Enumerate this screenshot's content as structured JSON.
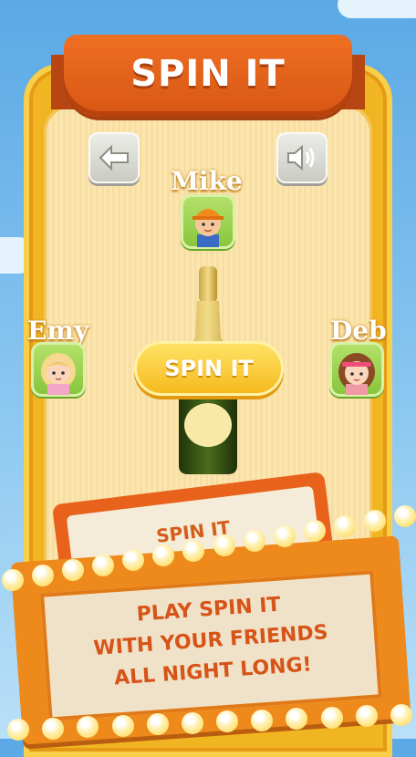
{
  "header": {
    "title": "SPIN IT"
  },
  "buttons": {
    "back": "back-arrow-icon",
    "sound": "speaker-icon",
    "spin": "SPIN IT"
  },
  "players": [
    {
      "name": "Mike",
      "icon": "boy-worker-avatar-icon"
    },
    {
      "name": "Emy",
      "icon": "blonde-girl-avatar-icon"
    },
    {
      "name": "Deb",
      "icon": "girl-headband-avatar-icon"
    }
  ],
  "promo": {
    "sign_title": "SPIN IT",
    "lines": [
      "PLAY SPIN IT",
      "WITH YOUR FRIENDS",
      "ALL NIGHT LONG!"
    ]
  },
  "colors": {
    "orange": "#e8621c",
    "yellow": "#f2b522",
    "green": "#86c43b",
    "bottle": "#2f4a16"
  }
}
